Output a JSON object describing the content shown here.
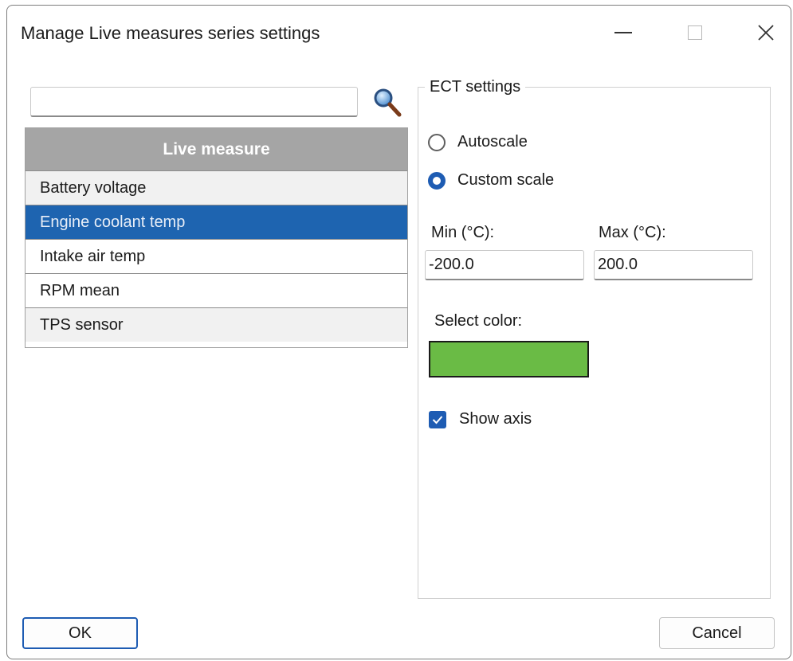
{
  "window": {
    "title": "Manage Live measures series settings"
  },
  "search": {
    "value": "",
    "placeholder": ""
  },
  "list": {
    "header": "Live measure",
    "items": [
      {
        "label": "Battery voltage"
      },
      {
        "label": "Engine coolant temp"
      },
      {
        "label": "Intake air temp"
      },
      {
        "label": "RPM mean"
      },
      {
        "label": "TPS sensor"
      }
    ],
    "selected": "Engine coolant temp"
  },
  "settings": {
    "group_title": "ECT settings",
    "autoscale_label": "Autoscale",
    "custom_scale_label": "Custom scale",
    "scale_mode": "Custom scale",
    "min_label": "Min (°C):",
    "max_label": "Max (°C):",
    "min_value": "-200.0",
    "max_value": "200.0",
    "color_label": "Select color:",
    "color": "#6abb45",
    "show_axis_label": "Show axis",
    "show_axis": true
  },
  "buttons": {
    "ok": "OK",
    "cancel": "Cancel"
  },
  "colors": {
    "accent": "#1e5cb3",
    "selection": "#1e64b0",
    "header": "#a5a5a5"
  },
  "icons": {
    "search": "search-icon",
    "minimize": "minimize-icon",
    "maximize": "maximize-icon",
    "close": "close-icon",
    "check": "checkmark-icon"
  }
}
